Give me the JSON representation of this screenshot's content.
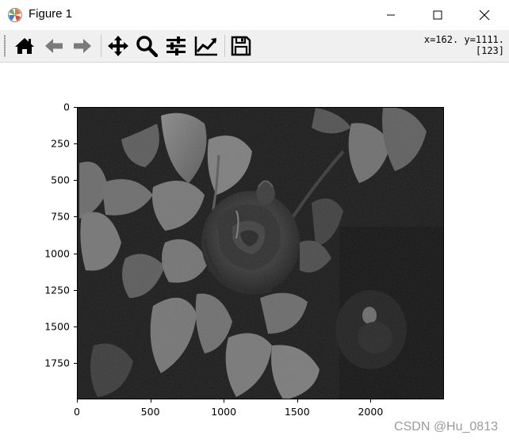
{
  "window": {
    "title": "Figure 1",
    "app_icon": "matplotlib-icon",
    "controls": [
      "minimize-icon",
      "maximize-icon",
      "close-icon"
    ]
  },
  "toolbar": {
    "buttons": [
      {
        "name": "home-button",
        "icon": "home-icon"
      },
      {
        "name": "back-button",
        "icon": "arrow-left-icon"
      },
      {
        "name": "forward-button",
        "icon": "arrow-right-icon"
      },
      {
        "name": "pan-button",
        "icon": "move-icon"
      },
      {
        "name": "zoom-button",
        "icon": "magnifier-icon"
      },
      {
        "name": "subplots-button",
        "icon": "sliders-icon"
      },
      {
        "name": "edit-axes-button",
        "icon": "line-chart-icon"
      },
      {
        "name": "save-button",
        "icon": "floppy-disk-icon"
      }
    ],
    "coordinates": {
      "line1": "x=162. y=1111.",
      "line2": "[123]"
    }
  },
  "figure": {
    "image": "grayscale photograph of a rose with leaves",
    "y_ticks": [
      "0",
      "250",
      "500",
      "750",
      "1000",
      "1250",
      "1500",
      "1750"
    ],
    "x_ticks": [
      "0",
      "500",
      "1000",
      "1500",
      "2000"
    ],
    "x_range": [
      0,
      2500
    ],
    "y_range": [
      0,
      2000
    ]
  },
  "watermark": "CSDN @Hu_0813",
  "colors": {
    "toolbar_bg": "#f0f0f0",
    "text": "#000000",
    "watermark": "#9a9a9a"
  }
}
